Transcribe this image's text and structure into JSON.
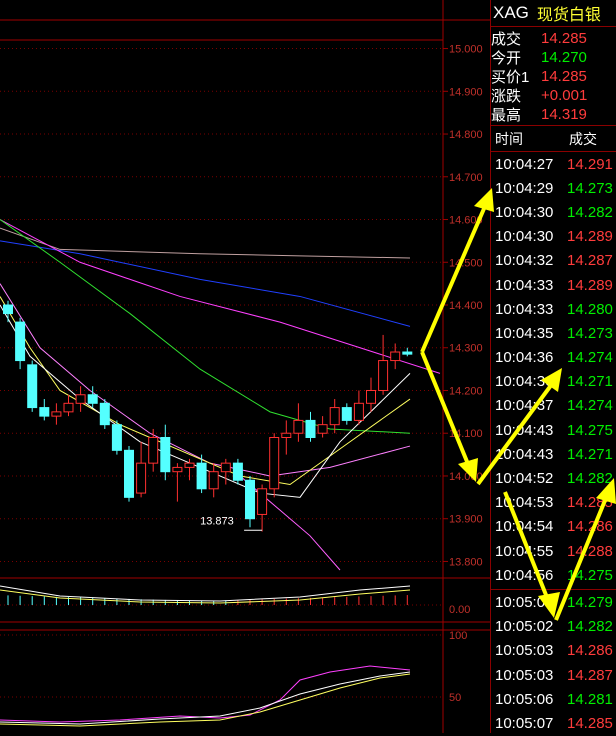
{
  "chart_data": {
    "type": "candlestick",
    "price_axis": {
      "ylim": [
        13.78,
        15.02
      ],
      "ticks": [
        "15.000",
        "14.900",
        "14.800",
        "14.700",
        "14.600",
        "14.500",
        "14.400",
        "14.300",
        "14.200",
        "14.100",
        "14.000",
        "13.900",
        "13.800"
      ]
    },
    "min_label": "13.873",
    "candles": [
      {
        "o": 14.4,
        "h": 14.41,
        "l": 14.36,
        "c": 14.38
      },
      {
        "o": 14.36,
        "h": 14.37,
        "l": 14.25,
        "c": 14.27
      },
      {
        "o": 14.26,
        "h": 14.27,
        "l": 14.15,
        "c": 14.16
      },
      {
        "o": 14.16,
        "h": 14.18,
        "l": 14.13,
        "c": 14.14
      },
      {
        "o": 14.14,
        "h": 14.17,
        "l": 14.12,
        "c": 14.15
      },
      {
        "o": 14.15,
        "h": 14.19,
        "l": 14.14,
        "c": 14.17
      },
      {
        "o": 14.17,
        "h": 14.21,
        "l": 14.15,
        "c": 14.19
      },
      {
        "o": 14.19,
        "h": 14.21,
        "l": 14.16,
        "c": 14.17
      },
      {
        "o": 14.17,
        "h": 14.18,
        "l": 14.11,
        "c": 14.12
      },
      {
        "o": 14.12,
        "h": 14.13,
        "l": 14.05,
        "c": 14.06
      },
      {
        "o": 14.06,
        "h": 14.07,
        "l": 13.94,
        "c": 13.95
      },
      {
        "o": 13.96,
        "h": 14.08,
        "l": 13.95,
        "c": 14.03
      },
      {
        "o": 14.03,
        "h": 14.11,
        "l": 14.01,
        "c": 14.09
      },
      {
        "o": 14.09,
        "h": 14.12,
        "l": 13.99,
        "c": 14.01
      },
      {
        "o": 14.01,
        "h": 14.03,
        "l": 13.94,
        "c": 14.02
      },
      {
        "o": 14.02,
        "h": 14.04,
        "l": 13.99,
        "c": 14.03
      },
      {
        "o": 14.03,
        "h": 14.05,
        "l": 13.96,
        "c": 13.97
      },
      {
        "o": 13.97,
        "h": 14.03,
        "l": 13.95,
        "c": 14.01
      },
      {
        "o": 14.01,
        "h": 14.04,
        "l": 13.98,
        "c": 14.03
      },
      {
        "o": 14.03,
        "h": 14.04,
        "l": 13.98,
        "c": 13.99
      },
      {
        "o": 13.99,
        "h": 14.0,
        "l": 13.88,
        "c": 13.9
      },
      {
        "o": 13.91,
        "h": 13.98,
        "l": 13.87,
        "c": 13.97
      },
      {
        "o": 13.97,
        "h": 14.1,
        "l": 13.95,
        "c": 14.09
      },
      {
        "o": 14.09,
        "h": 14.13,
        "l": 14.05,
        "c": 14.1
      },
      {
        "o": 14.1,
        "h": 14.17,
        "l": 14.08,
        "c": 14.13
      },
      {
        "o": 14.13,
        "h": 14.15,
        "l": 14.08,
        "c": 14.09
      },
      {
        "o": 14.1,
        "h": 14.14,
        "l": 14.09,
        "c": 14.12
      },
      {
        "o": 14.12,
        "h": 14.18,
        "l": 14.1,
        "c": 14.16
      },
      {
        "o": 14.16,
        "h": 14.17,
        "l": 14.12,
        "c": 14.13
      },
      {
        "o": 14.13,
        "h": 14.2,
        "l": 14.12,
        "c": 14.17
      },
      {
        "o": 14.17,
        "h": 14.23,
        "l": 14.15,
        "c": 14.2
      },
      {
        "o": 14.2,
        "h": 14.33,
        "l": 14.19,
        "c": 14.27
      },
      {
        "o": 14.27,
        "h": 14.31,
        "l": 14.25,
        "c": 14.29
      },
      {
        "o": 14.29,
        "h": 14.3,
        "l": 14.28,
        "c": 14.285
      }
    ],
    "macd_axis_label": "0.00",
    "kdj_axis_ticks": [
      "100",
      "50"
    ]
  },
  "panel": {
    "symbol": "XAG",
    "name": "现货白银",
    "quotes": [
      {
        "label": "成交",
        "value": "14.285",
        "color": "red"
      },
      {
        "label": "今开",
        "value": "14.270",
        "color": "green"
      },
      {
        "label": "买价1",
        "value": "14.285",
        "color": "red"
      },
      {
        "label": "涨跌",
        "value": "+0.001",
        "color": "red"
      },
      {
        "label": "最高",
        "value": "14.319",
        "color": "red"
      }
    ],
    "ticks_header": {
      "time": "时间",
      "price": "成交"
    },
    "ticks": [
      {
        "time": "10:04:27",
        "price": "14.291",
        "color": "red"
      },
      {
        "time": "10:04:29",
        "price": "14.273",
        "color": "green"
      },
      {
        "time": "10:04:30",
        "price": "14.282",
        "color": "green"
      },
      {
        "time": "10:04:30",
        "price": "14.289",
        "color": "red"
      },
      {
        "time": "10:04:32",
        "price": "14.287",
        "color": "red"
      },
      {
        "time": "10:04:33",
        "price": "14.289",
        "color": "red"
      },
      {
        "time": "10:04:33",
        "price": "14.280",
        "color": "green"
      },
      {
        "time": "10:04:35",
        "price": "14.273",
        "color": "green"
      },
      {
        "time": "10:04:36",
        "price": "14.274",
        "color": "green"
      },
      {
        "time": "10:04:36",
        "price": "14.271",
        "color": "green"
      },
      {
        "time": "10:04:37",
        "price": "14.274",
        "color": "green"
      },
      {
        "time": "10:04:43",
        "price": "14.275",
        "color": "green"
      },
      {
        "time": "10:04:43",
        "price": "14.271",
        "color": "green"
      },
      {
        "time": "10:04:52",
        "price": "14.282",
        "color": "green"
      },
      {
        "time": "10:04:53",
        "price": "14.285",
        "color": "red"
      },
      {
        "time": "10:04:54",
        "price": "14.286",
        "color": "red"
      },
      {
        "time": "10:04:55",
        "price": "14.288",
        "color": "red"
      },
      {
        "time": "10:04:56",
        "price": "14.275",
        "color": "green"
      }
    ],
    "ticks2": [
      {
        "time": "10:05:01",
        "price": "14.279",
        "color": "green"
      },
      {
        "time": "10:05:02",
        "price": "14.282",
        "color": "green"
      },
      {
        "time": "10:05:03",
        "price": "14.286",
        "color": "red"
      },
      {
        "time": "10:05:03",
        "price": "14.287",
        "color": "red"
      },
      {
        "time": "10:05:06",
        "price": "14.281",
        "color": "green"
      },
      {
        "time": "10:05:07",
        "price": "14.285",
        "color": "red"
      }
    ]
  }
}
